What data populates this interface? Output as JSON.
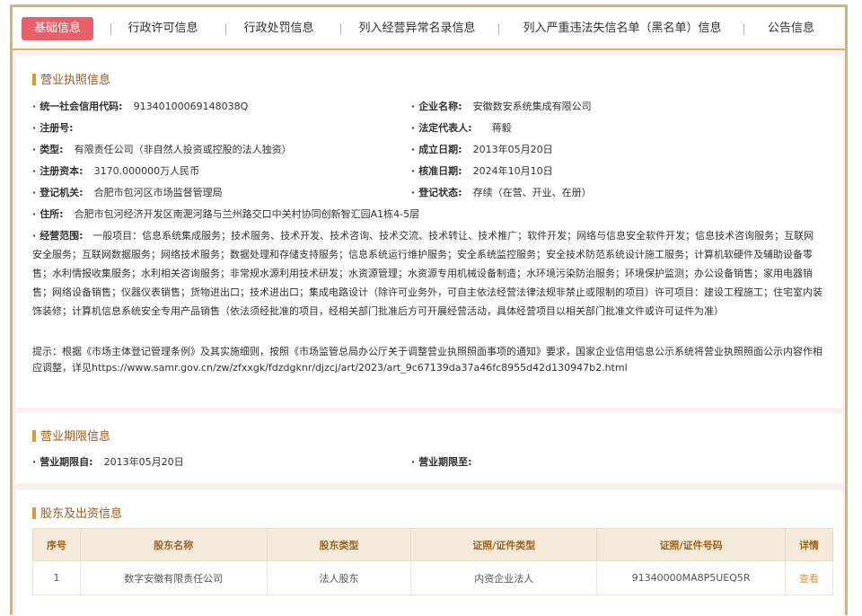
{
  "tabs": [
    {
      "label": "基础信息",
      "active": true
    },
    {
      "label": "行政许可信息"
    },
    {
      "label": "行政处罚信息"
    },
    {
      "label": "列入经营异常名录信息"
    },
    {
      "label": "列入严重违法失信名单（黑名单）信息"
    },
    {
      "label": "公告信息"
    }
  ],
  "license": {
    "title": "营业执照信息",
    "credit_code": {
      "label": "统一社会信用代码:",
      "value": "91340100069148038Q"
    },
    "company_name": {
      "label": "企业名称:",
      "value": "安徽数安系统集成有限公司"
    },
    "reg_no": {
      "label": "注册号:",
      "value": ""
    },
    "legal_rep": {
      "label": "法定代表人:",
      "value": "蒋毅"
    },
    "type": {
      "label": "类型:",
      "value": "有限责任公司（非自然人投资或控股的法人独资）"
    },
    "established": {
      "label": "成立日期:",
      "value": "2013年05月20日"
    },
    "capital": {
      "label": "注册资本:",
      "value": "3170.000000万人民币"
    },
    "approved": {
      "label": "核准日期:",
      "value": "2024年10月10日"
    },
    "authority": {
      "label": "登记机关:",
      "value": "合肥市包河区市场监督管理局"
    },
    "status": {
      "label": "登记状态:",
      "value": "存续（在营、开业、在册）"
    },
    "address": {
      "label": "住所:",
      "value": "合肥市包河经济开发区南淝河路与兰州路交口中关村协同创新智汇园A1栋4-5层"
    },
    "scope_label": "经营范围:",
    "scope_value": "一般项目：信息系统集成服务；技术服务、技术开发、技术咨询、技术交流、技术转让、技术推广；软件开发；网络与信息安全软件开发；信息技术咨询服务；互联网安全服务；互联网数据服务；网络技术服务；数据处理和存储支持服务；信息系统运行维护服务；安全系统监控服务；安全技术防范系统设计施工服务；计算机软硬件及辅助设备零售；水利情报收集服务；水利相关咨询服务；非常规水源利用技术研发；水资源管理；水资源专用机械设备制造；水环境污染防治服务；环境保护监测；办公设备销售；家用电器销售；网络设备销售；仪器仪表销售；货物进出口；技术进出口；集成电路设计（除许可业务外，可自主依法经营法律法规非禁止或限制的项目）许可项目：建设工程施工；住宅室内装饰装修；计算机信息系统安全专用产品销售（依法须经批准的项目，经相关部门批准后方可开展经营活动，具体经营项目以相关部门批准文件或许可证件为准）",
    "tip": "提示：根据《市场主体登记管理条例》及其实施细则，按照《市场监管总局办公厅关于调整营业执照照面事项的通知》要求，国家企业信用信息公示系统将营业执照照面公示内容作相应调整，详见https://www.samr.gov.cn/zw/zfxxgk/fdzdgknr/djzcj/art/2023/art_9c67139da37a46fc8955d42d130947b2.html"
  },
  "period": {
    "title": "营业期限信息",
    "from": {
      "label": "营业期限自:",
      "value": "2013年05月20日"
    },
    "to": {
      "label": "营业期限至:",
      "value": ""
    }
  },
  "shareholders": {
    "title": "股东及出资信息",
    "columns": [
      "序号",
      "股东名称",
      "股东类型",
      "证照/证件类型",
      "证照/证件号码",
      "详情"
    ],
    "rows": [
      {
        "no": "1",
        "name": "数字安徽有限责任公司",
        "type": "法人股东",
        "cert_type": "内资企业法人",
        "cert_no": "91340000MA8P5UEQ5R",
        "detail": "查看"
      }
    ]
  }
}
